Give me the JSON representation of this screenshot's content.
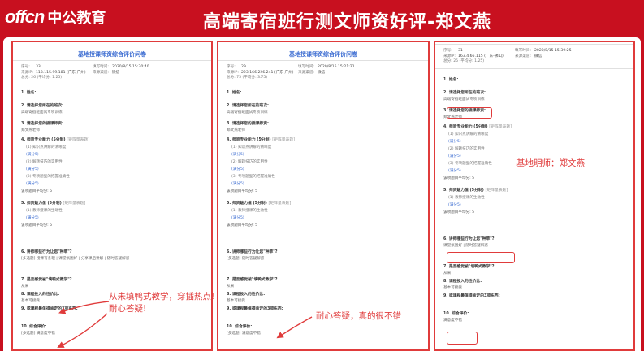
{
  "header": {
    "brand_latin": "offcn",
    "brand_cn": "中公教育",
    "title": "高端寄宿班行测文师资好评-郑文燕"
  },
  "colors": {
    "brand_red": "#c8101f",
    "link_blue": "#3a6bd1",
    "annotation_red": "#e03b3b"
  },
  "docs": [
    {
      "heading": "基地授课师资综合评价问卷",
      "meta": {
        "seq_key": "序号:",
        "seq_val": "33",
        "ip_key": "来源IP:",
        "ip_val": "113.115.99.181 (广东-广州)",
        "time_key": "填写时间:",
        "time_val": "2020/8/15 15:30:40",
        "channel_key": "来源渠道:",
        "channel_val": "微信",
        "score_text": "总分: 26 (平均分: 1.25)"
      },
      "questions": [
        {
          "t": "1. 姓名:",
          "a": ""
        },
        {
          "t": "2. 请选择您所在的班次:",
          "a": "高端寄宿班面试专项训练"
        },
        {
          "t": "3. 请选择您的授课师资:",
          "a": "郑文燕老师"
        },
        {
          "t": "4. 师资专业能力 (5分制)",
          "hint": "[矩阵量表题]",
          "subs": [
            "(1) 知识点讲解的清晰度",
            "(2) 解题技巧的实用性",
            "(3) 专项题型的把握准确性"
          ],
          "avg": "该项题目平均分: 5"
        },
        {
          "t": "5. 师资魅力值 (5分制)",
          "hint": "[矩阵量表题]",
          "subs": [
            "(1) 教师授课的生动性"
          ],
          "avg": "该项题目平均分: 5"
        },
        {
          "t": "6. 讲师哪些行为让您\"种草\"?",
          "a": "[多选题] 授课有条理 | 课堂氛围好 | 分享课后讲解 | 随时答疑解惑"
        },
        {
          "t": "7. 是否感觉被\"填鸭式教学\"?",
          "a": "从来"
        },
        {
          "t": "8. 课程投入的性价比:",
          "a": "基本可接受"
        },
        {
          "t": "9. 或课程最值得肯定的3项东西:",
          "a": ""
        },
        {
          "t": "10. 综合评价:",
          "a": "[多选题] 满意度不错"
        }
      ],
      "rating_link": "(满分5)"
    },
    {
      "heading": "基地授课师资综合评价问卷",
      "meta": {
        "seq_key": "序号:",
        "seq_val": "29",
        "ip_key": "来源IP:",
        "ip_val": "223.166.226.241 (广东-广州)",
        "time_key": "填写时间:",
        "time_val": "2020/8/15 15:21:21",
        "channel_key": "来源渠道:",
        "channel_val": "微信",
        "score_text": "总分: 75 (平均分: 3.75)"
      },
      "questions": [
        {
          "t": "1. 姓名:",
          "a": ""
        },
        {
          "t": "2. 请选择您所在的班次:",
          "a": "高端寄宿班面试专项训练"
        },
        {
          "t": "3. 请选择您的授课师资:",
          "a": "郑文燕老师"
        },
        {
          "t": "4. 师资专业能力 (5分制)",
          "hint": "[矩阵量表题]",
          "subs": [
            "(1) 知识点讲解的清晰度",
            "(2) 解题技巧的实用性",
            "(3) 专项题型的把握准确性"
          ],
          "avg": "该项题目平均分: 5"
        },
        {
          "t": "5. 师资魅力值 (5分制)",
          "hint": "[矩阵量表题]",
          "subs": [
            "(1) 教师授课的生动性"
          ],
          "avg": "该项题目平均分: 5"
        },
        {
          "t": "6. 讲师哪些行为让您\"种草\"?",
          "a": "[多选题] 随时答疑解惑"
        },
        {
          "t": "7. 是否感觉被\"填鸭式教学\"?",
          "a": "从来"
        },
        {
          "t": "8. 课程投入的性价比:",
          "a": "基本可接受"
        },
        {
          "t": "9. 或课程最值得肯定的3项东西:",
          "a": ""
        },
        {
          "t": "10. 综合评价:",
          "a": "[多选题] 满意度不错"
        }
      ],
      "rating_link": "(满分5)"
    },
    {
      "meta": {
        "seq_key": "序号:",
        "seq_val": "31",
        "ip_key": "来源IP:",
        "ip_val": "163.4.66.115 (广东-佛山)",
        "time_key": "填写时间:",
        "time_val": "2020/8/15 15:39:25",
        "channel_key": "来源渠道:",
        "channel_val": "微信",
        "score_text": "总分: 25 (平均分: 1.25)"
      },
      "questions": [
        {
          "t": "1. 姓名:",
          "a": ""
        },
        {
          "t": "2. 请选择您所在的班次:",
          "a": "高端寄宿班面试专项训练"
        },
        {
          "t": "3. 请选择您的授课师资:",
          "a": "郑文燕老师"
        },
        {
          "t": "4. 师资专业能力 (5分制)",
          "hint": "[矩阵量表题]",
          "subs": [
            "(1) 知识点讲解的清晰度",
            "(2) 解题技巧的实用性",
            "(3) 专项题型的把握准确性"
          ],
          "avg": "该项题目平均分: 5"
        },
        {
          "t": "5. 师资魅力值 (5分制)",
          "hint": "[矩阵量表题]",
          "subs": [
            "(1) 教师授课的生动性"
          ],
          "avg": "该项题目平均分: 5"
        },
        {
          "t": "6. 讲师哪些行为让您\"种草\"?",
          "a": "课堂氛围好 | 随时答疑解惑"
        },
        {
          "t": "7. 是否感觉被\"填鸭式教学\"?",
          "a": "从来"
        },
        {
          "t": "8. 课程投入的性价比:",
          "a": "基本可接受"
        },
        {
          "t": "9. 或课程最值得肯定的3项东西:",
          "a": ""
        },
        {
          "t": "10. 综合评价:",
          "a": "满意度不错"
        }
      ],
      "rating_link": "(满分5)"
    }
  ],
  "annotations": {
    "doc1": "从未填鸭式教学，穿插热点!\n耐心答疑!",
    "doc2": "耐心答疑，真的很不错",
    "doc3": "基地明师：郑文燕"
  }
}
